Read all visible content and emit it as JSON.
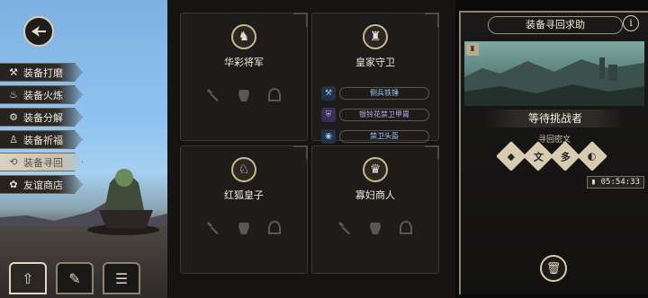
{
  "menu": [
    {
      "label": "装备打磨",
      "icon": "hammer-icon",
      "glyph": "⚒"
    },
    {
      "label": "装备火炼",
      "icon": "flame-icon",
      "glyph": "♨"
    },
    {
      "label": "装备分解",
      "icon": "gear-break-icon",
      "glyph": "⚙"
    },
    {
      "label": "装备祈福",
      "icon": "pray-icon",
      "glyph": "♙"
    },
    {
      "label": "装备寻回",
      "icon": "retrieve-icon",
      "glyph": "⟲"
    },
    {
      "label": "友谊商店",
      "icon": "shop-icon",
      "glyph": "✿"
    }
  ],
  "characters": [
    {
      "name": "华彩将军",
      "portrait": "general-portrait-icon",
      "glyph": "♞",
      "equips": []
    },
    {
      "name": "皇家守卫",
      "portrait": "royal-guard-portrait-icon",
      "glyph": "♜",
      "equips": [
        {
          "label": "侧兵铁锤",
          "icon": "hammer-icon",
          "glyph": "⚒",
          "tone": "blue"
        },
        {
          "label": "银铃花禁卫甲胄",
          "icon": "armor-icon",
          "glyph": "⛨",
          "tone": "purple"
        },
        {
          "label": "禁卫头盔",
          "icon": "helmet-icon",
          "glyph": "◉",
          "tone": "blue"
        }
      ]
    },
    {
      "name": "红狐皇子",
      "portrait": "red-fox-prince-portrait-icon",
      "glyph": "♘",
      "equips": []
    },
    {
      "name": "寡妇商人",
      "portrait": "widow-merchant-portrait-icon",
      "glyph": "♛",
      "equips": []
    }
  ],
  "panel": {
    "title": "装备寻回求助",
    "info_glyph": "i",
    "challenger": "等待挑战者",
    "runes_label": "寻回密文",
    "runes": [
      "◆",
      "文",
      "多",
      "◐"
    ],
    "timer": "05:54:33"
  },
  "colors": {
    "accent": "#c9b88e",
    "blue_item": "#9cc7f0",
    "purple_item": "#c7a8f0"
  }
}
